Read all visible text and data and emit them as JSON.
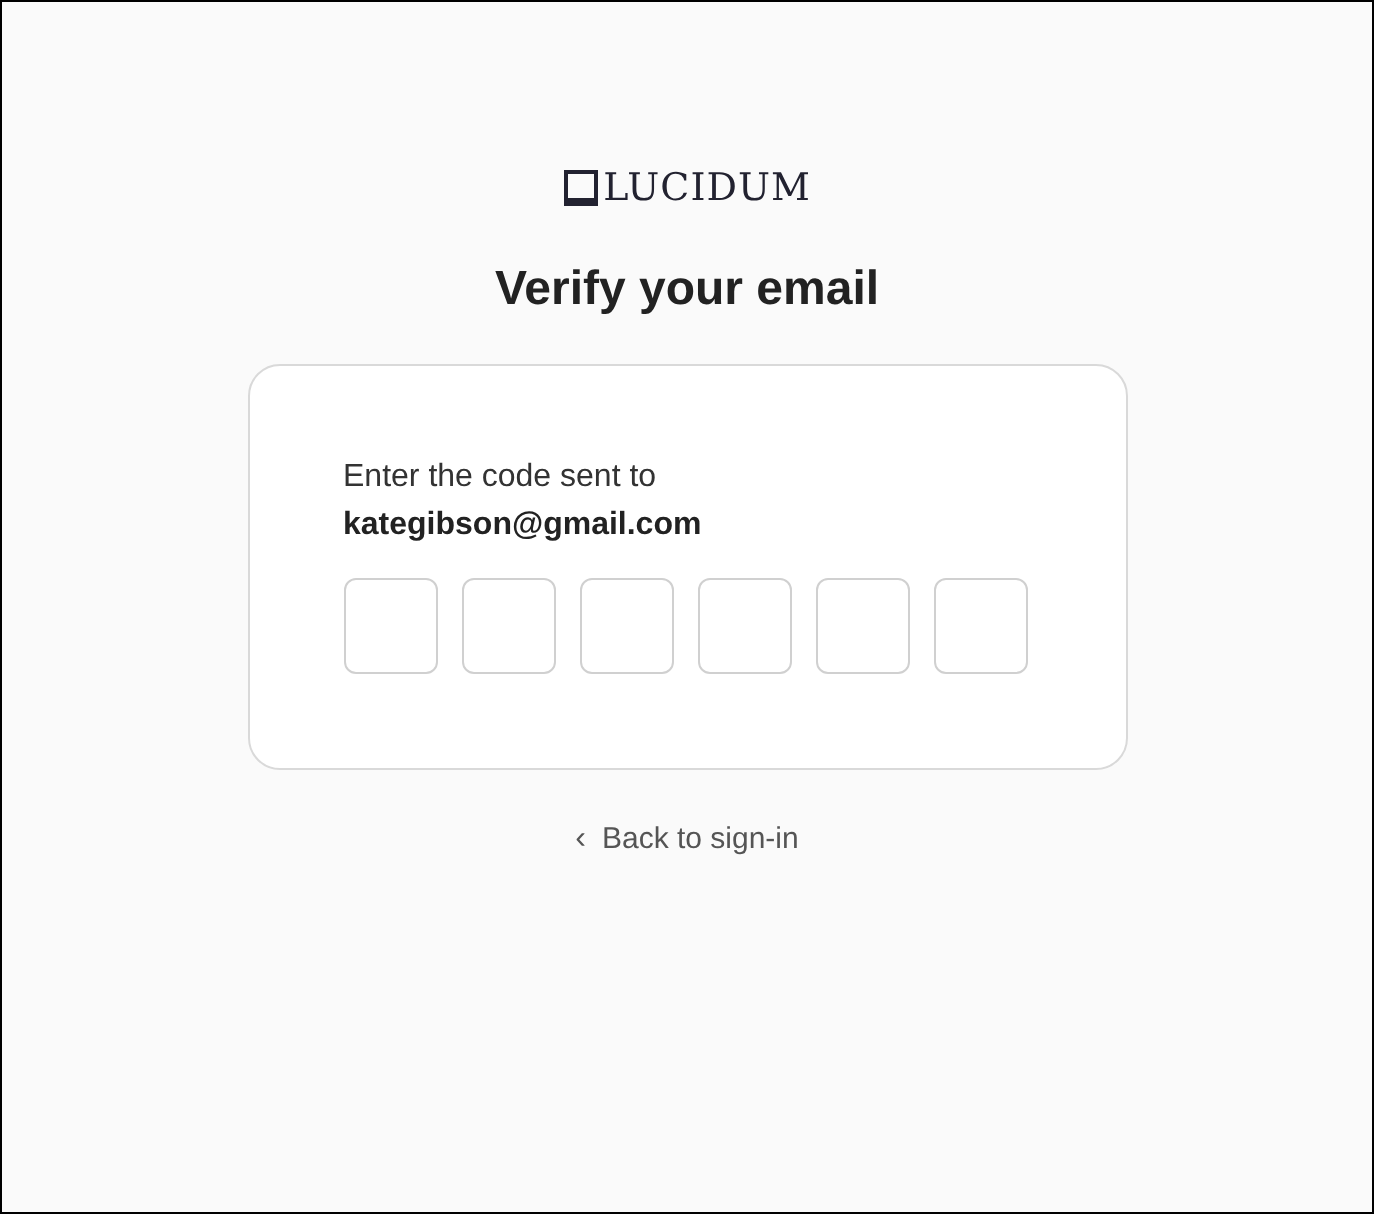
{
  "logo": {
    "text": "LUCIDUM"
  },
  "heading": "Verify your email",
  "card": {
    "prompt": "Enter the code sent to",
    "email": "kategibson@gmail.com",
    "code_fields": [
      {
        "kind": "digit"
      },
      {
        "kind": "digit"
      },
      {
        "kind": "digit"
      },
      {
        "kind": "digit"
      },
      {
        "kind": "digit"
      },
      {
        "kind": "digit"
      }
    ]
  },
  "back_link": {
    "icon": "‹",
    "label": "Back to sign-in"
  }
}
